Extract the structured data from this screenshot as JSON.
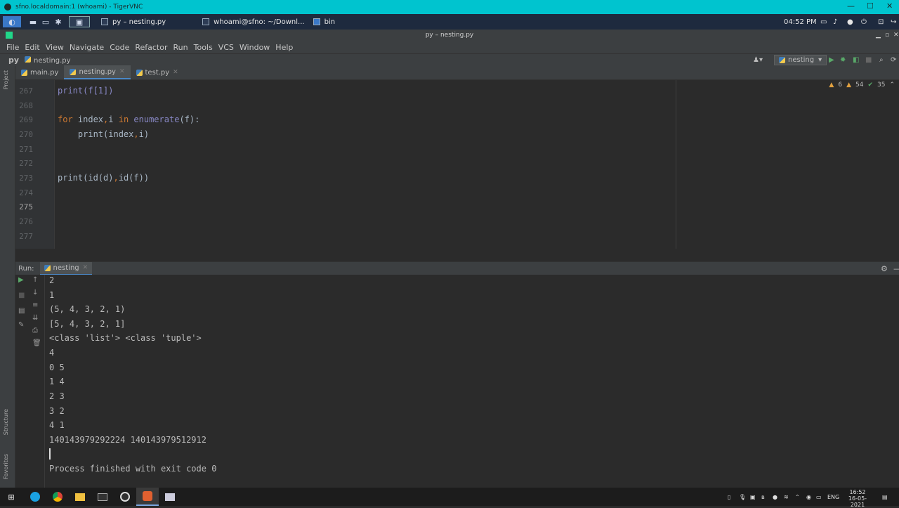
{
  "vnc": {
    "title": "sfno.localdomain:1 (whoami) - TigerVNC",
    "controls": [
      "—",
      "☐",
      "✕"
    ]
  },
  "panel": {
    "tasks": [
      {
        "label": "py – nesting.py"
      },
      {
        "label": "whoami@sfno: ~/Downl..."
      },
      {
        "label": "bin"
      }
    ],
    "clock": "04:52 PM"
  },
  "ide": {
    "title": "py – nesting.py",
    "menu": [
      "File",
      "Edit",
      "View",
      "Navigate",
      "Code",
      "Refactor",
      "Run",
      "Tools",
      "VCS",
      "Window",
      "Help"
    ],
    "breadcrumb": {
      "project": "py",
      "file": "nesting.py"
    },
    "run_config": "nesting",
    "tabs": [
      {
        "label": "main.py"
      },
      {
        "label": "nesting.py"
      },
      {
        "label": "test.py"
      }
    ],
    "side_labels": {
      "project": "Project",
      "structure": "Structure",
      "favorites": "Favorites"
    },
    "inspections": {
      "warnings": "6",
      "weak": "54",
      "ok": "35"
    },
    "line_numbers": [
      "267",
      "268",
      "269",
      "270",
      "271",
      "272",
      "273",
      "274",
      "275",
      "276",
      "277"
    ],
    "code": {
      "l267": "print(f[1])",
      "l269_kw": "for",
      "l269_a": " index",
      "l269_b": ",",
      "l269_c": "i ",
      "l269_in": "in",
      "l269_fn": " enumerate",
      "l269_d": "(f):",
      "l270": "    print(index",
      "l270_comma": ",",
      "l270_end": "i)",
      "l273_a": "print(id(d)",
      "l273_comma": ",",
      "l273_b": "id(f))"
    }
  },
  "run": {
    "label": "Run:",
    "tab": "nesting",
    "output": [
      "2",
      "1",
      "(5, 4, 3, 2, 1)",
      "[5, 4, 3, 2, 1]",
      "<class 'list'> <class 'tuple'>",
      "4",
      "0 5",
      "1 4",
      "2 3",
      "3 2",
      "4 1",
      "140143979292224 140143979512912",
      "",
      "Process finished with exit code 0"
    ]
  },
  "taskbar": {
    "lang": "ENG",
    "time": "16:52",
    "date": "16-05-2021"
  }
}
